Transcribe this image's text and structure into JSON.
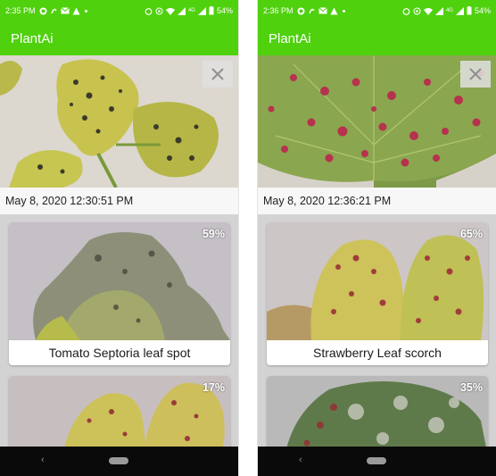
{
  "screens": [
    {
      "status": {
        "time": "2:35 PM",
        "battery": "54%",
        "network": "4G"
      },
      "app_title": "PlantAi",
      "timestamp": "May 8, 2020 12:30:51 PM",
      "results": [
        {
          "confidence": "59%",
          "label": "Tomato Septoria leaf spot"
        },
        {
          "confidence": "17%"
        }
      ]
    },
    {
      "status": {
        "time": "2:36 PM",
        "battery": "54%",
        "network": "4G"
      },
      "app_title": "PlantAi",
      "timestamp": "May 8, 2020 12:36:21 PM",
      "results": [
        {
          "confidence": "65%",
          "label": "Strawberry Leaf scorch"
        },
        {
          "confidence": "35%"
        }
      ]
    }
  ],
  "colors": {
    "accent": "#4fd10e",
    "results_bg": "#d3d3d3",
    "navbar": "#0a0a0a"
  }
}
